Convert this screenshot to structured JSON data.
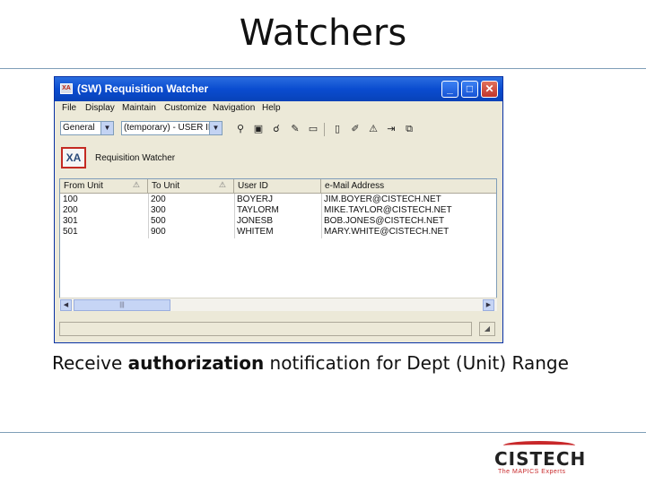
{
  "slide": {
    "title": "Watchers",
    "caption_pre": "Receive ",
    "caption_bold": "authorization",
    "caption_post": " notification for Dept (Unit) Range"
  },
  "window": {
    "icon_text": "XA",
    "title": "(SW) Requisition Watcher",
    "minimize": "_",
    "maximize": "□",
    "close": "✕"
  },
  "menu": [
    "File",
    "Display",
    "Maintain",
    "Customize",
    "Navigation",
    "Help"
  ],
  "toolbar": {
    "view_combo": "General",
    "filter_combo": "(temporary) - USER ID",
    "combo_arrow": "▼",
    "tools": [
      "binoculars-icon",
      "find-icon",
      "glasses-icon",
      "note-icon",
      "select-icon",
      "new-icon",
      "edit-icon",
      "properties-icon",
      "export-icon",
      "copy-icon"
    ],
    "tool_glyphs": [
      "⚲",
      "▣",
      "☌",
      "✎",
      "▭",
      "▯",
      "✐",
      "⚠",
      "⇥",
      "⧉"
    ]
  },
  "badge": {
    "icon_text": "XA",
    "label": "Requisition Watcher"
  },
  "grid": {
    "sort_glyph": "⚠",
    "columns": [
      "From Unit",
      "To Unit",
      "User ID",
      "e-Mail Address"
    ],
    "rows": [
      [
        "100",
        "200",
        "BOYERJ",
        "JIM.BOYER@CISTECH.NET"
      ],
      [
        "200",
        "300",
        "TAYLORM",
        "MIKE.TAYLOR@CISTECH.NET"
      ],
      [
        "301",
        "500",
        "JONESB",
        "BOB.JONES@CISTECH.NET"
      ],
      [
        "501",
        "900",
        "WHITEM",
        "MARY.WHITE@CISTECH.NET"
      ]
    ]
  },
  "scroll": {
    "left": "◀",
    "right": "▶",
    "grip": "|||"
  },
  "status": {
    "resize_glyph": "◢"
  },
  "logo": {
    "text": "CISTECH",
    "tagline": "The MAPICS Experts"
  }
}
